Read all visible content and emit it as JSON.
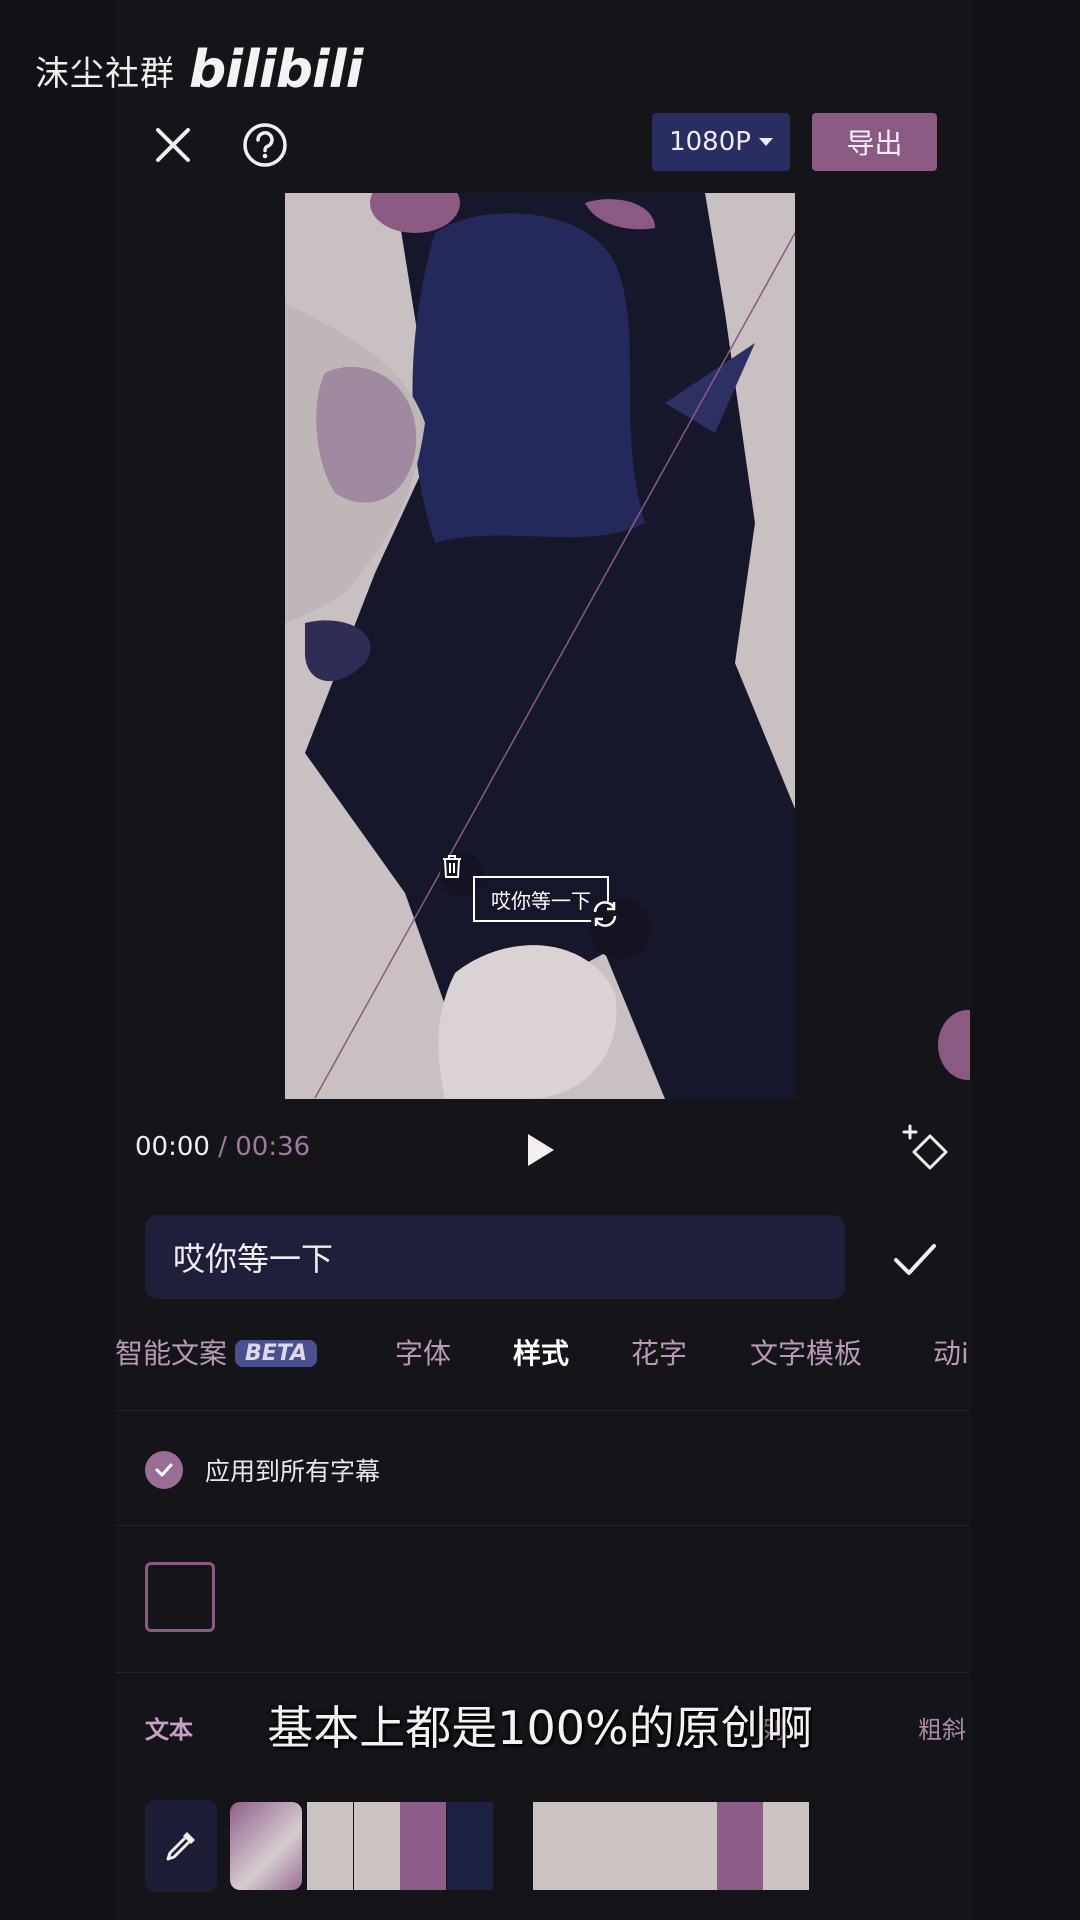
{
  "watermark": {
    "text": "沫尘社群",
    "logo": "bilibili"
  },
  "topbar": {
    "resolution": "1080P",
    "export_label": "导出"
  },
  "preview": {
    "subtitle_text": "哎你等一下"
  },
  "playback": {
    "current": "00:00",
    "separator": " / ",
    "total": "00:36"
  },
  "editor": {
    "input_value": "哎你等一下"
  },
  "tabs": {
    "smart_copy": "智能文案",
    "beta": "BETA",
    "font": "字体",
    "style": "样式",
    "fancy": "花字",
    "template": "文字模板",
    "animation": "动i"
  },
  "apply_all_label": "应用到所有字幕",
  "subtabs": {
    "text": "文本",
    "arrange": "列",
    "bold_italic": "粗斜"
  },
  "caption": "基本上都是100%的原创啊",
  "colors": {
    "accent": "#8a5a82",
    "navy": "#2a2d62",
    "swatches": [
      "#cbc3c2",
      "#cbc3c2",
      "#8e5c88",
      "#1e2142",
      "#cbc3c2",
      "#cbc3c2",
      "#cbc3c2",
      "#cbc3c2",
      "#8e5c88",
      "#cbc3c2"
    ]
  }
}
